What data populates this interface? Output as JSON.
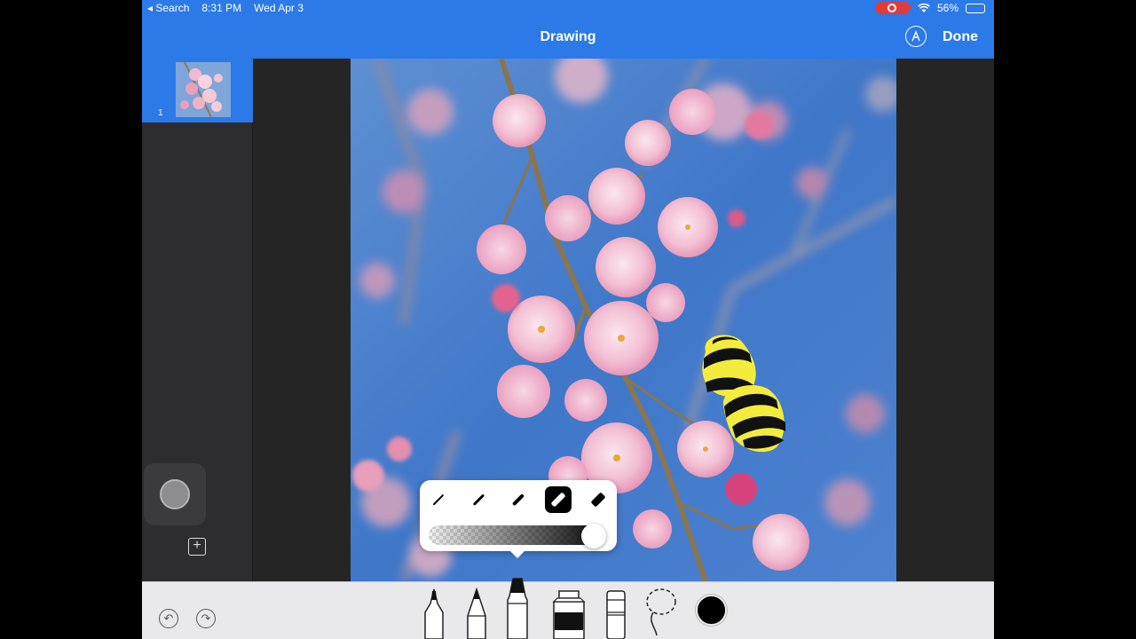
{
  "status": {
    "back_label": "◂ Search",
    "time": "8:31 PM",
    "date": "Wed Apr 3",
    "battery": "56%",
    "battery_level": 0.56
  },
  "nav": {
    "title": "Drawing",
    "markup_icon": "markup-pen-icon",
    "done_label": "Done"
  },
  "sidebar": {
    "pages": [
      {
        "number": "1"
      }
    ],
    "add_page_icon": "plus-square-icon"
  },
  "canvas": {
    "image": "cherry-blossom-photo",
    "drawing": "bumblebee-sketch"
  },
  "popover": {
    "stroke_widths": [
      "extra-thin",
      "thin",
      "medium",
      "thick",
      "extra-thick"
    ],
    "selected_width": "thick",
    "opacity": 0.98
  },
  "toolbar": {
    "undo_icon": "undo-icon",
    "redo_icon": "redo-icon",
    "tools": [
      "pen",
      "pencil",
      "marker",
      "paint-bucket",
      "eraser",
      "lasso"
    ],
    "selected_tool": "marker",
    "color": "#000000"
  },
  "colors": {
    "accent": "#2c79e8",
    "record": "#e23b3b"
  }
}
